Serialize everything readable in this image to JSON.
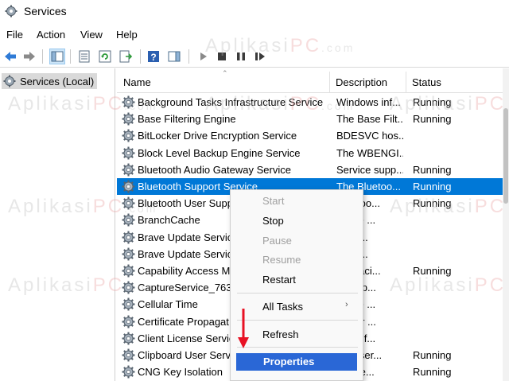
{
  "window": {
    "title": "Services"
  },
  "menu": [
    "File",
    "Action",
    "View",
    "Help"
  ],
  "tree": {
    "root_label": "Services (Local)"
  },
  "columns": {
    "name": "Name",
    "description": "Description",
    "status": "Status"
  },
  "services": [
    {
      "name": "Background Tasks Infrastructure Service",
      "description": "Windows inf...",
      "status": "Running"
    },
    {
      "name": "Base Filtering Engine",
      "description": "The Base Filt...",
      "status": "Running"
    },
    {
      "name": "BitLocker Drive Encryption Service",
      "description": "BDESVC hos...",
      "status": ""
    },
    {
      "name": "Block Level Backup Engine Service",
      "description": "The WBENGI...",
      "status": ""
    },
    {
      "name": "Bluetooth Audio Gateway Service",
      "description": "Service supp...",
      "status": "Running"
    },
    {
      "name": "Bluetooth Support Service",
      "description": "The Bluetoo...",
      "status": "Running"
    },
    {
      "name": "Bluetooth User Supp",
      "description": "Bluetoo...",
      "status": "Running"
    },
    {
      "name": "BranchCache",
      "description": "ervice ...",
      "status": ""
    },
    {
      "name": "Brave Update Servic",
      "description": "your ...",
      "status": ""
    },
    {
      "name": "Brave Update Servic",
      "description": "your ...",
      "status": ""
    },
    {
      "name": "Capability Access M",
      "description": "des faci...",
      "status": "Running"
    },
    {
      "name": "CaptureService_763",
      "description": "des op...",
      "status": ""
    },
    {
      "name": "Cellular Time",
      "description": "ervice ...",
      "status": ""
    },
    {
      "name": "Certificate Propagat",
      "description": "s user ...",
      "status": ""
    },
    {
      "name": "Client License Servic",
      "description": "des inf...",
      "status": ""
    },
    {
      "name": "Clipboard User Serv",
      "description": "user ser...",
      "status": "Running"
    },
    {
      "name": "CNG Key Isolation",
      "description": "NG ke...",
      "status": "Running"
    }
  ],
  "context_menu": {
    "start": "Start",
    "stop": "Stop",
    "pause": "Pause",
    "resume": "Resume",
    "restart": "Restart",
    "all_tasks": "All Tasks",
    "refresh": "Refresh",
    "properties": "Properties"
  },
  "icons": {
    "back": "back-arrow-icon",
    "forward": "forward-arrow-icon",
    "start_service": "play-icon",
    "stop_service": "stop-icon",
    "pause_service": "pause-icon",
    "restart_service": "restart-icon"
  },
  "colors": {
    "selection": "#0078d7",
    "toolbar_blue": "#2f7bd6",
    "annotation_arrow": "#e81123"
  },
  "watermark": {
    "part1": "Aplikasi",
    "part2": "PC",
    "part3": ".com"
  }
}
